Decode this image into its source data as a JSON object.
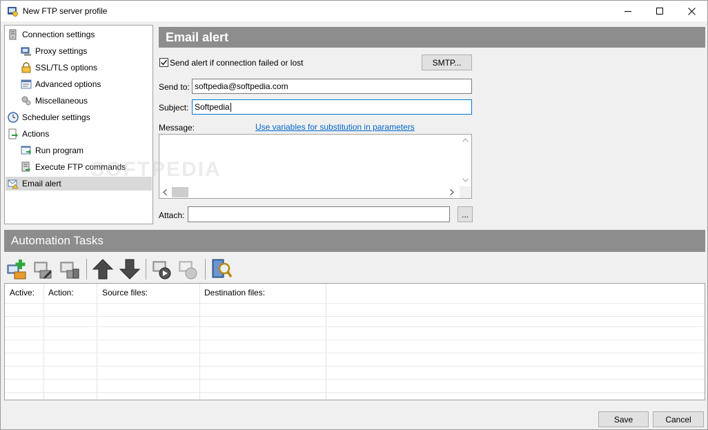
{
  "window": {
    "title": "New FTP server profile",
    "controls": {
      "minimize": "minimize",
      "maximize": "maximize",
      "close": "close"
    }
  },
  "tree": {
    "items": [
      {
        "label": "Connection settings",
        "icon": "server-icon"
      },
      {
        "label": "Proxy settings",
        "icon": "proxy-icon"
      },
      {
        "label": "SSL/TLS options",
        "icon": "lock-icon"
      },
      {
        "label": "Advanced options",
        "icon": "options-icon"
      },
      {
        "label": "Miscellaneous",
        "icon": "misc-icon"
      },
      {
        "label": "Scheduler settings",
        "icon": "clock-icon"
      },
      {
        "label": "Actions",
        "icon": "actions-icon"
      },
      {
        "label": "Run program",
        "icon": "run-icon"
      },
      {
        "label": "Execute FTP commands",
        "icon": "ftp-commands-icon"
      },
      {
        "label": "Email alert",
        "icon": "email-alert-icon",
        "selected": true
      }
    ]
  },
  "email": {
    "header": "Email alert",
    "send_alert_label": "Send alert if connection failed or lost",
    "send_alert_checked": true,
    "smtp_button": "SMTP...",
    "send_to_label": "Send to:",
    "send_to_value": "softpedia@softpedia.com",
    "subject_label": "Subject:",
    "subject_value": "Softpedia",
    "message_label": "Message:",
    "variables_link": "Use variables for substitution in parameters",
    "message_value": "",
    "attach_label": "Attach:",
    "attach_value": "",
    "browse_button": "..."
  },
  "watermark": "SOFTPEDIA",
  "automation": {
    "header": "Automation Tasks",
    "toolbar": [
      {
        "name": "add-task",
        "icon": "add-task-icon"
      },
      {
        "name": "edit-task",
        "icon": "edit-task-icon"
      },
      {
        "name": "delete-task",
        "icon": "delete-task-icon"
      },
      {
        "name": "move-up",
        "icon": "arrow-up-icon"
      },
      {
        "name": "move-down",
        "icon": "arrow-down-icon"
      },
      {
        "name": "run-task",
        "icon": "run-task-icon"
      },
      {
        "name": "stop-task",
        "icon": "stop-task-icon"
      },
      {
        "name": "view-log",
        "icon": "search-log-icon"
      }
    ],
    "columns": [
      "Active:",
      "Action:",
      "Source files:",
      "Destination files:"
    ],
    "rows": []
  },
  "footer": {
    "save": "Save",
    "cancel": "Cancel"
  }
}
